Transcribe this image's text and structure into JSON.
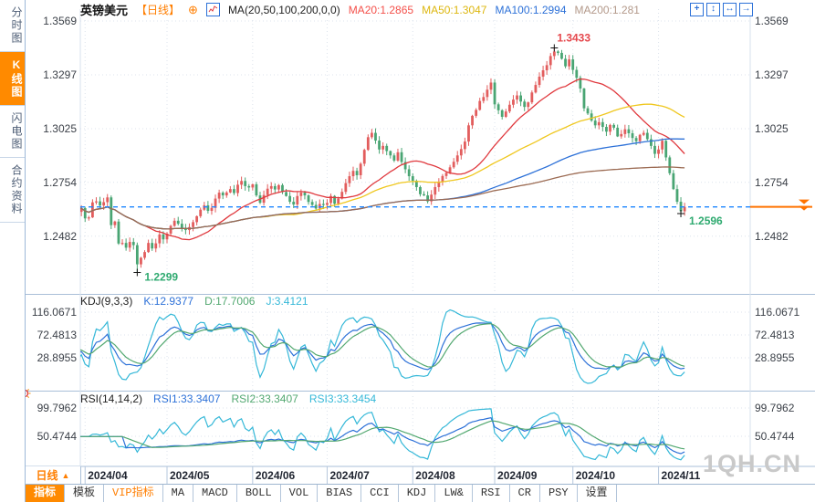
{
  "window": {
    "watermark": "1QH.CN"
  },
  "sidebar": {
    "items": [
      {
        "id": "time-share-chart",
        "label": "分时图",
        "active": false
      },
      {
        "id": "kline-chart",
        "label": "K线图",
        "active": true
      },
      {
        "id": "lightning-chart",
        "label": "闪电图",
        "active": false
      },
      {
        "id": "contract-info",
        "label": "合约资料",
        "active": false
      }
    ]
  },
  "header": {
    "title": "英镑美元",
    "period_tag": "【日线】",
    "plus_icon": "⊕",
    "ma_label": "MA(20,50,100,200,0,0)",
    "ma20": "MA20:1.2865",
    "ma50": "MA50:1.3047",
    "ma100": "MA100:1.2994",
    "ma200": "MA200:1.281",
    "icons": [
      {
        "id": "crosshair",
        "glyph": "+"
      },
      {
        "id": "zoom-vertical",
        "glyph": "↕"
      },
      {
        "id": "zoom-horizontal",
        "glyph": "↔"
      },
      {
        "id": "pan-right",
        "glyph": "→"
      }
    ]
  },
  "kdj_header": {
    "name": "KDJ(9,3,3)",
    "k": "K:12.9377",
    "d": "D:17.7006",
    "j": "J:3.4121"
  },
  "rsi_header": {
    "name": "RSI(14,14,2)",
    "rsi1": "RSI1:33.3407",
    "rsi2": "RSI2:33.3407",
    "rsi3": "RSI3:33.3454"
  },
  "period_selector": {
    "label": "日线",
    "arrow": "▲"
  },
  "toolbar": {
    "tabs": [
      {
        "id": "indicators",
        "label": "指标",
        "style": "active"
      },
      {
        "id": "templates",
        "label": "模板",
        "style": ""
      },
      {
        "id": "vip-indicators",
        "label": "VIP指标",
        "style": "vip"
      },
      {
        "id": "ma",
        "label": "MA",
        "style": ""
      },
      {
        "id": "macd",
        "label": "MACD",
        "style": ""
      },
      {
        "id": "boll",
        "label": "BOLL",
        "style": ""
      },
      {
        "id": "vol",
        "label": "VOL",
        "style": ""
      },
      {
        "id": "bias",
        "label": "BIAS",
        "style": ""
      },
      {
        "id": "cci",
        "label": "CCI",
        "style": ""
      },
      {
        "id": "kdj",
        "label": "KDJ",
        "style": ""
      },
      {
        "id": "lwr",
        "label": "LW&",
        "style": ""
      },
      {
        "id": "rsi",
        "label": "RSI",
        "style": ""
      },
      {
        "id": "cr",
        "label": "CR",
        "style": ""
      },
      {
        "id": "psy",
        "label": "PSY",
        "style": ""
      },
      {
        "id": "settings",
        "label": "设置",
        "style": ""
      }
    ]
  },
  "chart_data": {
    "type": "candlestick",
    "symbol": "英镑美元",
    "interval": "日线",
    "y_axis_main": {
      "ticks": [
        {
          "value": 1.3569,
          "label": "1.3569"
        },
        {
          "value": 1.3297,
          "label": "1.3297"
        },
        {
          "value": 1.3025,
          "label": "1.3025"
        },
        {
          "value": 1.2754,
          "label": "1.2754"
        },
        {
          "value": 1.2482,
          "label": "1.2482"
        }
      ]
    },
    "y_axis_kdj": {
      "ticks": [
        {
          "value": 116.0671,
          "label": "116.0671"
        },
        {
          "value": 72.4813,
          "label": "72.4813"
        },
        {
          "value": 28.8955,
          "label": "28.8955"
        }
      ]
    },
    "y_axis_rsi": {
      "ticks": [
        {
          "value": 99.7962,
          "label": "99.7962"
        },
        {
          "value": 50.4744,
          "label": "50.4744"
        }
      ]
    },
    "x_axis": {
      "months": [
        {
          "label": "2024/04",
          "index": 3
        },
        {
          "label": "2024/05",
          "index": 25
        },
        {
          "label": "2024/06",
          "index": 48
        },
        {
          "label": "2024/07",
          "index": 68
        },
        {
          "label": "2024/08",
          "index": 91
        },
        {
          "label": "2024/09",
          "index": 113
        },
        {
          "label": "2024/10",
          "index": 134
        },
        {
          "label": "2024/11",
          "index": 157
        }
      ]
    },
    "first_open": 1.2652,
    "last_price": 1.263,
    "closes": [
      1.2638,
      1.2605,
      1.2624,
      1.2572,
      1.2577,
      1.2653,
      1.2658,
      1.2637,
      1.2654,
      1.2678,
      1.2538,
      1.2556,
      1.2445,
      1.2448,
      1.2424,
      1.2453,
      1.2437,
      1.234,
      1.2373,
      1.2402,
      1.2448,
      1.242,
      1.2446,
      1.2491,
      1.2466,
      1.2495,
      1.2534,
      1.256,
      1.2545,
      1.2522,
      1.2513,
      1.2528,
      1.2553,
      1.2583,
      1.2616,
      1.2638,
      1.261,
      1.2625,
      1.2672,
      1.2702,
      1.2688,
      1.2703,
      1.272,
      1.27,
      1.2742,
      1.2761,
      1.2735,
      1.2728,
      1.2744,
      1.2688,
      1.2651,
      1.269,
      1.2722,
      1.2735,
      1.2718,
      1.274,
      1.2705,
      1.2685,
      1.2656,
      1.2642,
      1.2685,
      1.2702,
      1.2688,
      1.2655,
      1.264,
      1.2622,
      1.2645,
      1.264,
      1.265,
      1.2685,
      1.2646,
      1.2672,
      1.2706,
      1.275,
      1.2785,
      1.2812,
      1.279,
      1.2848,
      1.2918,
      1.2982,
      1.3004,
      1.2965,
      1.292,
      1.2938,
      1.2912,
      1.289,
      1.2864,
      1.2906,
      1.2857,
      1.282,
      1.2785,
      1.2762,
      1.273,
      1.2694,
      1.2688,
      1.2658,
      1.2692,
      1.273,
      1.2758,
      1.2786,
      1.2802,
      1.283,
      1.2858,
      1.289,
      1.2922,
      1.296,
      1.3042,
      1.309,
      1.312,
      1.3165,
      1.3185,
      1.3222,
      1.3258,
      1.3148,
      1.3118,
      1.3085,
      1.3112,
      1.3146,
      1.3172,
      1.3193,
      1.3162,
      1.3135,
      1.3158,
      1.3208,
      1.3246,
      1.3288,
      1.332,
      1.3346,
      1.3392,
      1.3415,
      1.3408,
      1.3378,
      1.334,
      1.3375,
      1.3322,
      1.3282,
      1.3228,
      1.3128,
      1.3102,
      1.3066,
      1.3042,
      1.3058,
      1.3034,
      1.301,
      1.3044,
      1.303,
      1.2986,
      1.2998,
      1.3022,
      1.3002,
      1.2978,
      1.2962,
      1.2994,
      1.3004,
      1.2972,
      1.2938,
      1.2898,
      1.292,
      1.2964,
      1.288,
      1.28,
      1.272,
      1.2656,
      1.2608,
      1.263
    ],
    "annotations": {
      "high": {
        "index": 129,
        "value": 1.3433,
        "label": "1.3433"
      },
      "low": {
        "index": 17,
        "value": 1.2299,
        "label": "1.2299"
      },
      "recent_low": {
        "index": 163,
        "value": 1.2596,
        "label": "1.2596"
      }
    },
    "ma_series": [
      {
        "name": "MA20",
        "window": 20,
        "color": "#e0393e"
      },
      {
        "name": "MA50",
        "window": 50,
        "color": "#efc71e"
      },
      {
        "name": "MA100",
        "window": 100,
        "color": "#2d71d8"
      },
      {
        "name": "MA200",
        "window": 200,
        "color": "#9b6a52"
      }
    ],
    "colors": {
      "up": "#e25d5d",
      "down": "#49a573",
      "k": "#2d71d8",
      "d": "#52a870",
      "j": "#35b8d8",
      "rsi1": "#2d71d8",
      "rsi2": "#52a870",
      "rsi3": "#35b8d8",
      "last_price_line": "#1e86ff",
      "price_marker": "#ff7300",
      "grid": "#dce3ec",
      "divider": "#a9bfd8",
      "plot_edge": "#d7e0ec",
      "axis_text": "#3a3f47",
      "date_text": "#1f2430",
      "annotation_up": "#e5484d",
      "annotation_down": "#2faa70",
      "cross_marker": "#111111"
    }
  }
}
